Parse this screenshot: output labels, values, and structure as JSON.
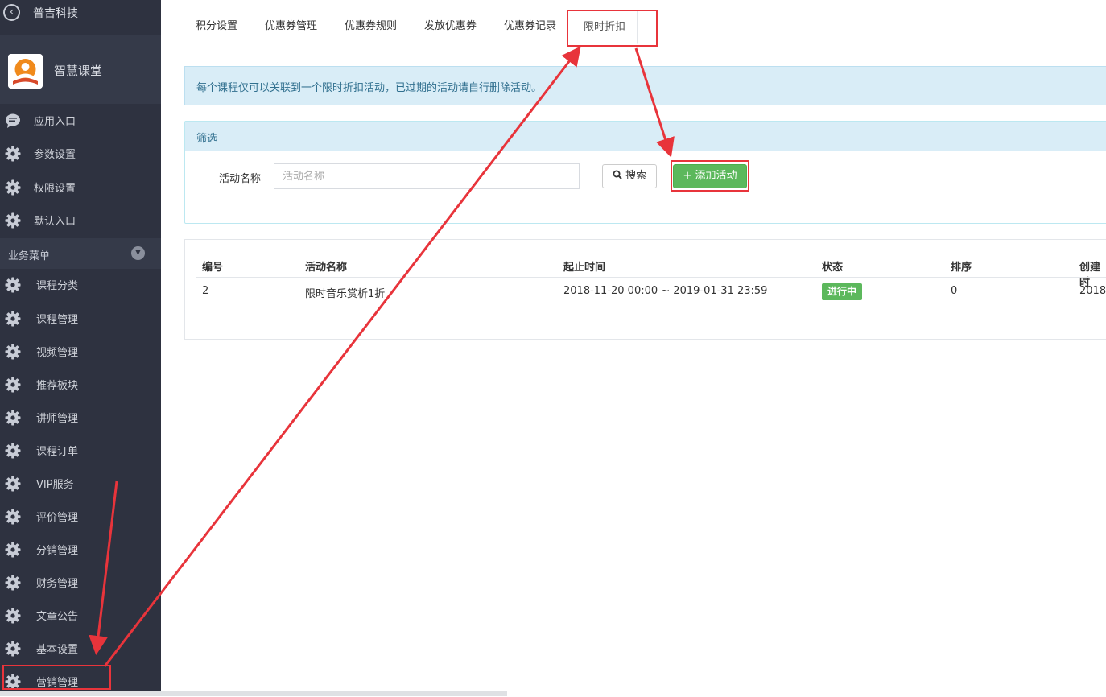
{
  "sidebar": {
    "org_name": "普吉科技",
    "app_name": "智慧课堂",
    "top_items": [
      {
        "label": "应用入口",
        "icon": "comment-icon"
      },
      {
        "label": "参数设置",
        "icon": "gear-icon"
      },
      {
        "label": "权限设置",
        "icon": "gear-icon"
      },
      {
        "label": "默认入口",
        "icon": "gear-icon"
      }
    ],
    "section_label": "业务菜单",
    "items": [
      {
        "label": "课程分类"
      },
      {
        "label": "课程管理"
      },
      {
        "label": "视频管理"
      },
      {
        "label": "推荐板块"
      },
      {
        "label": "讲师管理"
      },
      {
        "label": "课程订单"
      },
      {
        "label": "VIP服务"
      },
      {
        "label": "评价管理"
      },
      {
        "label": "分销管理"
      },
      {
        "label": "财务管理"
      },
      {
        "label": "文章公告"
      },
      {
        "label": "基本设置"
      },
      {
        "label": "营销管理"
      }
    ]
  },
  "tabs": [
    {
      "label": "积分设置"
    },
    {
      "label": "优惠券管理"
    },
    {
      "label": "优惠券规则"
    },
    {
      "label": "发放优惠券"
    },
    {
      "label": "优惠券记录"
    },
    {
      "label": "限时折扣",
      "active": true
    }
  ],
  "notice": "每个课程仅可以关联到一个限时折扣活动，已过期的活动请自行删除活动。",
  "filter": {
    "title": "筛选",
    "label": "活动名称",
    "placeholder": "活动名称",
    "search_label": "搜索",
    "add_label": "添加活动"
  },
  "table": {
    "headers": [
      "编号",
      "活动名称",
      "起止时间",
      "状态",
      "排序",
      "创建时"
    ],
    "rows": [
      {
        "id": "2",
        "name": "限时音乐赏析1折",
        "period": "2018-11-20 00:00 ~ 2019-01-31 23:59",
        "status": "进行中",
        "sort": "0",
        "created": "2018-"
      }
    ]
  },
  "colors": {
    "sidebar_bg": "#2e3240",
    "accent_green": "#5cb85c",
    "info_bg": "#d9edf7",
    "annotation_red": "#e8343b"
  }
}
